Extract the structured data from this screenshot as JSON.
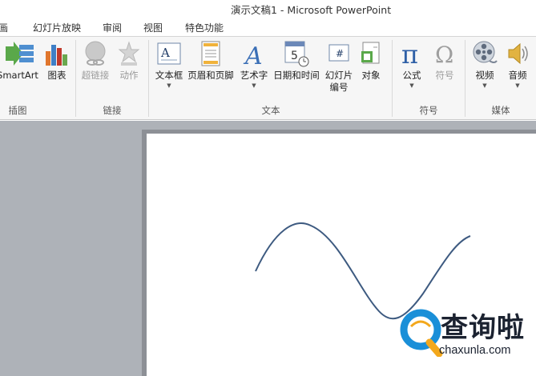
{
  "window": {
    "title": "演示文稿1 - Microsoft PowerPoint"
  },
  "tabs": [
    {
      "label": "画"
    },
    {
      "label": "幻灯片放映"
    },
    {
      "label": "审阅"
    },
    {
      "label": "视图"
    },
    {
      "label": "特色功能"
    }
  ],
  "ribbon": {
    "groups": {
      "illustrations": "插图",
      "links": "链接",
      "text": "文本",
      "symbols": "符号",
      "media": "媒体"
    },
    "buttons": {
      "smartart": "SmartArt",
      "chart": "图表",
      "hyperlink": "超链接",
      "action": "动作",
      "textbox": "文本框",
      "header_footer": "页眉和页脚",
      "wordart": "艺术字",
      "datetime": "日期和时间",
      "slide_number_line1": "幻灯片",
      "slide_number_line2": "编号",
      "object": "对象",
      "equation": "公式",
      "symbol": "符号",
      "video": "视频",
      "audio": "音频"
    },
    "glyphs": {
      "textbox": "A",
      "wordart": "A",
      "datetime": "5",
      "slide_number": "#",
      "equation": "π",
      "symbol": "Ω"
    },
    "caret": "▼"
  },
  "watermark": {
    "brand": "查询啦",
    "url": "chaxunla.com"
  },
  "colors": {
    "curve": "#3d5a80",
    "workspace": "#aeb2b8",
    "ribbon": "#f6f6f6",
    "watermark_ring": "#1a8fd8",
    "watermark_tail": "#f3a81c"
  }
}
